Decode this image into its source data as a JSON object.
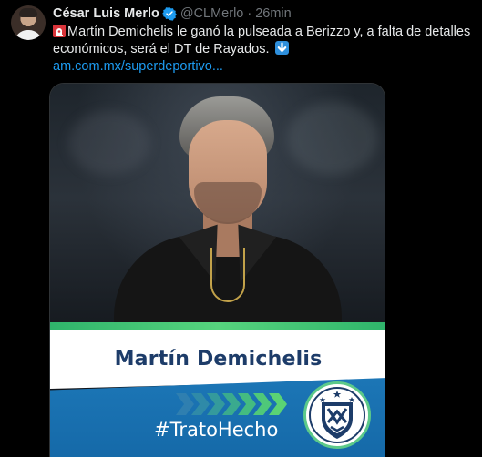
{
  "tweet": {
    "author_name": "César Luis Merlo",
    "handle": "@CLMerlo",
    "separator": "·",
    "time": "26min",
    "text_line_1": "Martín Demichelis le ganó la pulseada a Berizzo y, a falta de detalles",
    "text_line_2": "económicos, será el DT de Rayados.",
    "link_text": "am.com.mx/superdeportivo...",
    "icons": [
      "verified-badge-icon",
      "siren-emoji-icon",
      "down-arrow-emoji-icon"
    ]
  },
  "media": {
    "graphic_name": "Martín Demichelis",
    "hashtag": "#TratoHecho",
    "colors": {
      "name_text": "#1d3c69",
      "banner_blue": "#1c76b6",
      "accent_green": "#5cc98a",
      "link_blue": "#1d9bf0"
    }
  }
}
